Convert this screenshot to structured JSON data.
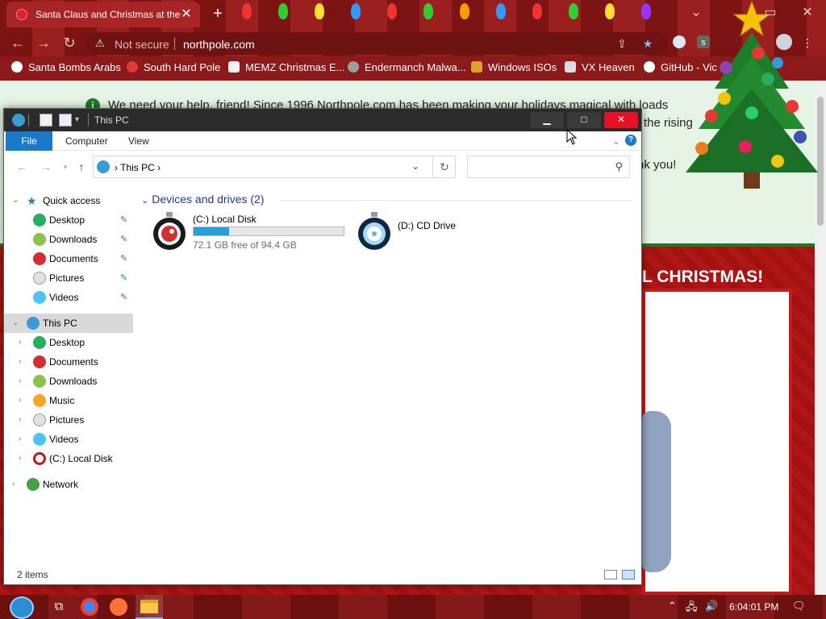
{
  "browser": {
    "tab_title": "Santa Claus and Christmas at the",
    "tab_close": "✕",
    "new_tab": "+",
    "security_label": "Not secure",
    "url": "northpole.com",
    "bookmarks": [
      {
        "label": "Santa Bombs Arabs",
        "color": "#ffffff"
      },
      {
        "label": "South Hard Pole",
        "color": "#e53935"
      },
      {
        "label": "MEMZ Christmas E...",
        "color": "#f2f2f2"
      },
      {
        "label": "Endermanch Malwa...",
        "color": "#9e9e9e"
      },
      {
        "label": "Windows ISOs",
        "color": "#e0a030"
      },
      {
        "label": "VX Heaven",
        "color": "#dddddd"
      },
      {
        "label": "GitHub - Vic",
        "color": "#ffffff"
      }
    ]
  },
  "webpage": {
    "banner_lines": [
      "We need your help, friend! Since 1996 Northpole.com has been making your holidays magical with loads",
      "the rising",
      "nk you!"
    ],
    "christmas_heading": "L CHRISTMAS!"
  },
  "explorer": {
    "title": "This PC",
    "ribbon_tabs": [
      "File",
      "Computer",
      "View"
    ],
    "address_crumb": "This PC",
    "nav_pane": {
      "quick_access": {
        "label": "Quick access",
        "items": [
          "Desktop",
          "Downloads",
          "Documents",
          "Pictures",
          "Videos"
        ]
      },
      "this_pc": {
        "label": "This PC",
        "items": [
          "Desktop",
          "Documents",
          "Downloads",
          "Music",
          "Pictures",
          "Videos",
          "(C:) Local Disk"
        ]
      },
      "network": "Network"
    },
    "group_header": "Devices and drives (2)",
    "drives": [
      {
        "name": "(C:) Local Disk",
        "free_text": "72.1 GB free of 94.4 GB",
        "used_fraction": 0.236
      },
      {
        "name": "(D:) CD Drive"
      }
    ],
    "status_count": "2 items"
  },
  "taskbar": {
    "clock": "6:04:01 PM"
  },
  "colors": {
    "accent_blue": "#1979ca",
    "drive_bar": "#26a0da",
    "browser_red": "#8a1a1a",
    "close_red": "#e81123"
  }
}
